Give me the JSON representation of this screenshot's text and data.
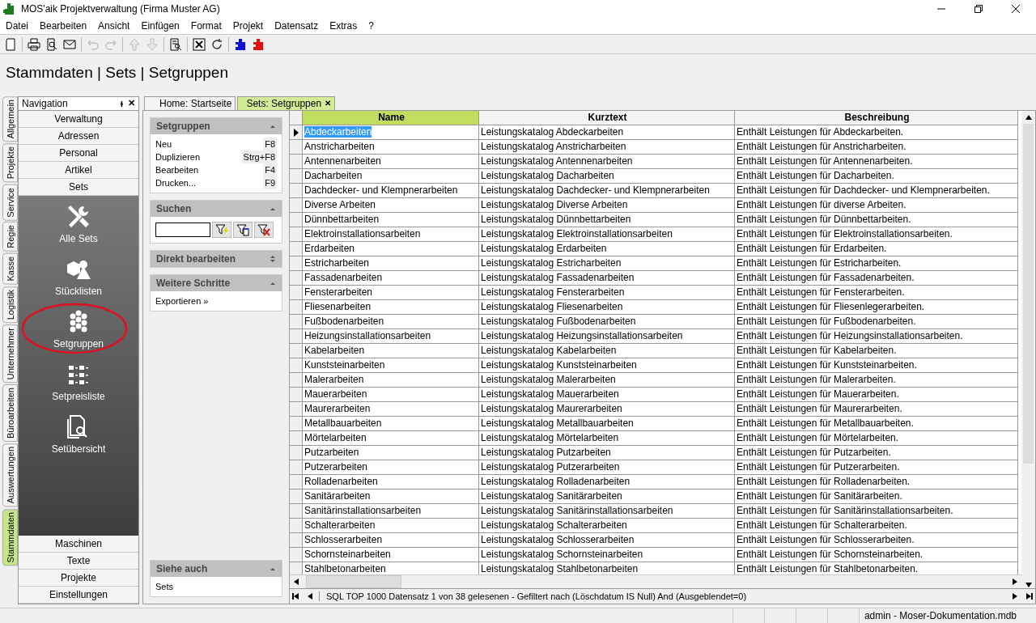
{
  "window": {
    "title": "MOS'aik Projektverwaltung (Firma Muster AG)"
  },
  "menu": [
    "Datei",
    "Bearbeiten",
    "Ansicht",
    "Einfügen",
    "Format",
    "Projekt",
    "Datensatz",
    "Extras",
    "?"
  ],
  "toolbar": [
    {
      "kind": "new",
      "disabled": false
    },
    {
      "kind": "separator"
    },
    {
      "kind": "print",
      "disabled": false
    },
    {
      "kind": "preview",
      "disabled": false
    },
    {
      "kind": "mail",
      "disabled": false
    },
    {
      "kind": "separator"
    },
    {
      "kind": "undo",
      "disabled": true
    },
    {
      "kind": "redo",
      "disabled": true
    },
    {
      "kind": "separator"
    },
    {
      "kind": "up",
      "disabled": true
    },
    {
      "kind": "down",
      "disabled": true
    },
    {
      "kind": "separator"
    },
    {
      "kind": "report",
      "disabled": false
    },
    {
      "kind": "separator"
    },
    {
      "kind": "close-doc",
      "disabled": false
    },
    {
      "kind": "refresh",
      "disabled": false
    },
    {
      "kind": "separator"
    },
    {
      "kind": "plugin-in",
      "disabled": false
    },
    {
      "kind": "plugin-out",
      "disabled": false
    }
  ],
  "heading": "Stammdaten | Sets | Setgruppen",
  "side_tabs": [
    {
      "label": "Allgemein",
      "selected": false
    },
    {
      "label": "Projekte",
      "selected": false
    },
    {
      "label": "Service",
      "selected": false
    },
    {
      "label": "Regie",
      "selected": false
    },
    {
      "label": "Kasse",
      "selected": false
    },
    {
      "label": "Logistik",
      "selected": false
    },
    {
      "label": "Unternehmer",
      "selected": false
    },
    {
      "label": "Büroarbeiten",
      "selected": false
    },
    {
      "label": "Auswertungen",
      "selected": false
    },
    {
      "label": "Stammdaten",
      "selected": true
    }
  ],
  "navigation": {
    "title": "Navigation",
    "pin": "ᵼ",
    "close": "✕",
    "top_items": [
      "Verwaltung",
      "Adressen",
      "Personal",
      "Artikel",
      "Sets"
    ],
    "big_items": [
      {
        "label": "Alle Sets",
        "kind": "tools",
        "highlighted": false
      },
      {
        "label": "Stücklisten",
        "kind": "shapes",
        "highlighted": false
      },
      {
        "label": "Setgruppen",
        "kind": "hexagons",
        "highlighted": true
      },
      {
        "label": "Setpreisliste",
        "kind": "list",
        "highlighted": false
      },
      {
        "label": "Setübersicht",
        "kind": "doc-search",
        "highlighted": false
      }
    ],
    "bottom_items": [
      "Maschinen",
      "Texte",
      "Projekte",
      "Einstellungen"
    ]
  },
  "doc_tabs": [
    {
      "label": "Home: Startseite",
      "selected": false
    },
    {
      "label": "Sets: Setgruppen",
      "selected": true,
      "close": "✕"
    }
  ],
  "tasks": {
    "sections": [
      {
        "title": "Setgruppen",
        "kind": "actions",
        "items": [
          {
            "label": "Neu",
            "key": "F8"
          },
          {
            "label": "Duplizieren",
            "key": "Strg+F8"
          },
          {
            "label": "Bearbeiten",
            "key": "F4"
          },
          {
            "label": "Drucken...",
            "key": "F9"
          }
        ]
      },
      {
        "title": "Suchen",
        "kind": "search"
      },
      {
        "title": "Direkt bearbeiten",
        "kind": "collapsed"
      },
      {
        "title": "Weitere Schritte",
        "kind": "links",
        "items": [
          {
            "label": "Exportieren »"
          }
        ]
      }
    ],
    "see_also": {
      "title": "Siehe auch",
      "items": [
        "Sets"
      ]
    }
  },
  "table": {
    "columns": [
      {
        "label": "Name",
        "selected": true
      },
      {
        "label": "Kurztext",
        "selected": false
      },
      {
        "label": "Beschreibung",
        "selected": false
      }
    ],
    "rows": [
      {
        "selected": true,
        "cells": [
          "Abdeckarbeiten",
          "Leistungskatalog Abdeckarbeiten",
          "Enthält Leistungen für Abdeckarbeiten."
        ]
      },
      {
        "selected": false,
        "cells": [
          "Anstricharbeiten",
          "Leistungskatalog Anstricharbeiten",
          "Enthält Leistungen für Anstricharbeiten."
        ]
      },
      {
        "selected": false,
        "cells": [
          "Antennenarbeiten",
          "Leistungskatalog Antennenarbeiten",
          "Enthält Leistungen für Antennenarbeiten."
        ]
      },
      {
        "selected": false,
        "cells": [
          "Dacharbeiten",
          "Leistungskatalog Dacharbeiten",
          "Enthält Leistungen für Dacharbeiten."
        ]
      },
      {
        "selected": false,
        "cells": [
          "Dachdecker- und Klempnerarbeiten",
          "Leistungskatalog Dachdecker- und Klempnerarbeiten",
          "Enthält Leistungen für Dachdecker- und Klempnerarbeiten."
        ]
      },
      {
        "selected": false,
        "cells": [
          "Diverse Arbeiten",
          "Leistungskatalog Diverse Arbeiten",
          "Enthält Leistungen für diverse Arbeiten."
        ]
      },
      {
        "selected": false,
        "cells": [
          "Dünnbettarbeiten",
          "Leistungskatalog Dünnbettarbeiten",
          "Enthält Leistungen für Dünnbettarbeiten."
        ]
      },
      {
        "selected": false,
        "cells": [
          "Elektroinstallationsarbeiten",
          "Leistungskatalog Elektroinstallationsarbeiten",
          "Enthält Leistungen für Elektroinstallationsarbeiten."
        ]
      },
      {
        "selected": false,
        "cells": [
          "Erdarbeiten",
          "Leistungskatalog Erdarbeiten",
          "Enthält Leistungen für Erdarbeiten."
        ]
      },
      {
        "selected": false,
        "cells": [
          "Estricharbeiten",
          "Leistungskatalog Estricharbeiten",
          "Enthält Leistungen für Estricharbeiten."
        ]
      },
      {
        "selected": false,
        "cells": [
          "Fassadenarbeiten",
          "Leistungskatalog Fassadenarbeiten",
          "Enthält Leistungen für Fassadenarbeiten."
        ]
      },
      {
        "selected": false,
        "cells": [
          "Fensterarbeiten",
          "Leistungskatalog Fensterarbeiten",
          "Enthält Leistungen für Fensterarbeiten."
        ]
      },
      {
        "selected": false,
        "cells": [
          "Fliesenarbeiten",
          "Leistungskatalog Fliesenarbeiten",
          "Enthält Leistungen für Fliesenlegerarbeiten."
        ]
      },
      {
        "selected": false,
        "cells": [
          "Fußbodenarbeiten",
          "Leistungskatalog Fußbodenarbeiten",
          "Enthält Leistungen für Fußbodenarbeiten."
        ]
      },
      {
        "selected": false,
        "cells": [
          "Heizungsinstallationsarbeiten",
          "Leistungskatalog Heizungsinstallationsarbeiten",
          "Enthält Leistungen für Heizungsinstallationsarbeiten."
        ]
      },
      {
        "selected": false,
        "cells": [
          "Kabelarbeiten",
          "Leistungskatalog Kabelarbeiten",
          "Enthält Leistungen für Kabelarbeiten."
        ]
      },
      {
        "selected": false,
        "cells": [
          "Kunststeinarbeiten",
          "Leistungskatalog Kunststeinarbeiten",
          "Enthält Leistungen für Kunststeinarbeiten."
        ]
      },
      {
        "selected": false,
        "cells": [
          "Malerarbeiten",
          "Leistungskatalog Malerarbeiten",
          "Enthält Leistungen für Malerarbeiten."
        ]
      },
      {
        "selected": false,
        "cells": [
          "Mauerarbeiten",
          "Leistungskatalog Mauerarbeiten",
          "Enthält Leistungen für Mauerarbeiten."
        ]
      },
      {
        "selected": false,
        "cells": [
          "Maurerarbeiten",
          "Leistungskatalog Maurerarbeiten",
          "Enthält Leistungen für Maurerarbeiten."
        ]
      },
      {
        "selected": false,
        "cells": [
          "Metallbauarbeiten",
          "Leistungskatalog Metallbauarbeiten",
          "Enthält Leistungen für Metallbauarbeiten."
        ]
      },
      {
        "selected": false,
        "cells": [
          "Mörtelarbeiten",
          "Leistungskatalog Mörtelarbeiten",
          "Enthält Leistungen für Mörtelarbeiten."
        ]
      },
      {
        "selected": false,
        "cells": [
          "Putzarbeiten",
          "Leistungskatalog Putzarbeiten",
          "Enthält Leistungen für Putzarbeiten."
        ]
      },
      {
        "selected": false,
        "cells": [
          "Putzerarbeiten",
          "Leistungskatalog Putzerarbeiten",
          "Enthält Leistungen für Putzerarbeiten."
        ]
      },
      {
        "selected": false,
        "cells": [
          "Rolladenarbeiten",
          "Leistungskatalog Rolladenarbeiten",
          "Enthält Leistungen für Rolladenarbeiten."
        ]
      },
      {
        "selected": false,
        "cells": [
          "Sanitärarbeiten",
          "Leistungskatalog Sanitärarbeiten",
          "Enthält Leistungen für Sanitärarbeiten."
        ]
      },
      {
        "selected": false,
        "cells": [
          "Sanitärinstallationsarbeiten",
          "Leistungskatalog Sanitärinstallationsarbeiten",
          "Enthält Leistungen für Sanitärinstallationsarbeiten."
        ]
      },
      {
        "selected": false,
        "cells": [
          "Schalterarbeiten",
          "Leistungskatalog Schalterarbeiten",
          "Enthält Leistungen für Schalterarbeiten."
        ]
      },
      {
        "selected": false,
        "cells": [
          "Schlosserarbeiten",
          "Leistungskatalog Schlosserarbeiten",
          "Enthält Leistungen für Schlosserarbeiten."
        ]
      },
      {
        "selected": false,
        "cells": [
          "Schornsteinarbeiten",
          "Leistungskatalog Schornsteinarbeiten",
          "Enthält Leistungen für Schornsteinarbeiten."
        ]
      },
      {
        "selected": false,
        "cells": [
          "Stahlbetonarbeiten",
          "Leistungskatalog Stahlbetonarbeiten",
          "Enthält Leistungen für Stahlbetonarbeiten."
        ]
      }
    ],
    "record_info": "SQL TOP 1000 Datensatz 1 von 38 gelesenen - Gefiltert nach (Löschdatum IS Null) And (Ausgeblendet=0)"
  },
  "status_bar": {
    "text": "admin - Moser-Dokumentation.mdb"
  }
}
